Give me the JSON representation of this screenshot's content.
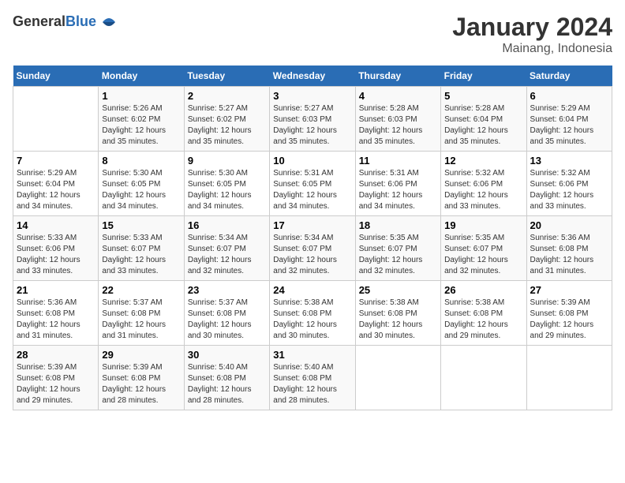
{
  "logo": {
    "general": "General",
    "blue": "Blue"
  },
  "title": "January 2024",
  "subtitle": "Mainang, Indonesia",
  "days_header": [
    "Sunday",
    "Monday",
    "Tuesday",
    "Wednesday",
    "Thursday",
    "Friday",
    "Saturday"
  ],
  "weeks": [
    [
      {
        "day": "",
        "sunrise": "",
        "sunset": "",
        "daylight": ""
      },
      {
        "day": "1",
        "sunrise": "Sunrise: 5:26 AM",
        "sunset": "Sunset: 6:02 PM",
        "daylight": "Daylight: 12 hours and 35 minutes."
      },
      {
        "day": "2",
        "sunrise": "Sunrise: 5:27 AM",
        "sunset": "Sunset: 6:02 PM",
        "daylight": "Daylight: 12 hours and 35 minutes."
      },
      {
        "day": "3",
        "sunrise": "Sunrise: 5:27 AM",
        "sunset": "Sunset: 6:03 PM",
        "daylight": "Daylight: 12 hours and 35 minutes."
      },
      {
        "day": "4",
        "sunrise": "Sunrise: 5:28 AM",
        "sunset": "Sunset: 6:03 PM",
        "daylight": "Daylight: 12 hours and 35 minutes."
      },
      {
        "day": "5",
        "sunrise": "Sunrise: 5:28 AM",
        "sunset": "Sunset: 6:04 PM",
        "daylight": "Daylight: 12 hours and 35 minutes."
      },
      {
        "day": "6",
        "sunrise": "Sunrise: 5:29 AM",
        "sunset": "Sunset: 6:04 PM",
        "daylight": "Daylight: 12 hours and 35 minutes."
      }
    ],
    [
      {
        "day": "7",
        "sunrise": "Sunrise: 5:29 AM",
        "sunset": "Sunset: 6:04 PM",
        "daylight": "Daylight: 12 hours and 34 minutes."
      },
      {
        "day": "8",
        "sunrise": "Sunrise: 5:30 AM",
        "sunset": "Sunset: 6:05 PM",
        "daylight": "Daylight: 12 hours and 34 minutes."
      },
      {
        "day": "9",
        "sunrise": "Sunrise: 5:30 AM",
        "sunset": "Sunset: 6:05 PM",
        "daylight": "Daylight: 12 hours and 34 minutes."
      },
      {
        "day": "10",
        "sunrise": "Sunrise: 5:31 AM",
        "sunset": "Sunset: 6:05 PM",
        "daylight": "Daylight: 12 hours and 34 minutes."
      },
      {
        "day": "11",
        "sunrise": "Sunrise: 5:31 AM",
        "sunset": "Sunset: 6:06 PM",
        "daylight": "Daylight: 12 hours and 34 minutes."
      },
      {
        "day": "12",
        "sunrise": "Sunrise: 5:32 AM",
        "sunset": "Sunset: 6:06 PM",
        "daylight": "Daylight: 12 hours and 33 minutes."
      },
      {
        "day": "13",
        "sunrise": "Sunrise: 5:32 AM",
        "sunset": "Sunset: 6:06 PM",
        "daylight": "Daylight: 12 hours and 33 minutes."
      }
    ],
    [
      {
        "day": "14",
        "sunrise": "Sunrise: 5:33 AM",
        "sunset": "Sunset: 6:06 PM",
        "daylight": "Daylight: 12 hours and 33 minutes."
      },
      {
        "day": "15",
        "sunrise": "Sunrise: 5:33 AM",
        "sunset": "Sunset: 6:07 PM",
        "daylight": "Daylight: 12 hours and 33 minutes."
      },
      {
        "day": "16",
        "sunrise": "Sunrise: 5:34 AM",
        "sunset": "Sunset: 6:07 PM",
        "daylight": "Daylight: 12 hours and 32 minutes."
      },
      {
        "day": "17",
        "sunrise": "Sunrise: 5:34 AM",
        "sunset": "Sunset: 6:07 PM",
        "daylight": "Daylight: 12 hours and 32 minutes."
      },
      {
        "day": "18",
        "sunrise": "Sunrise: 5:35 AM",
        "sunset": "Sunset: 6:07 PM",
        "daylight": "Daylight: 12 hours and 32 minutes."
      },
      {
        "day": "19",
        "sunrise": "Sunrise: 5:35 AM",
        "sunset": "Sunset: 6:07 PM",
        "daylight": "Daylight: 12 hours and 32 minutes."
      },
      {
        "day": "20",
        "sunrise": "Sunrise: 5:36 AM",
        "sunset": "Sunset: 6:08 PM",
        "daylight": "Daylight: 12 hours and 31 minutes."
      }
    ],
    [
      {
        "day": "21",
        "sunrise": "Sunrise: 5:36 AM",
        "sunset": "Sunset: 6:08 PM",
        "daylight": "Daylight: 12 hours and 31 minutes."
      },
      {
        "day": "22",
        "sunrise": "Sunrise: 5:37 AM",
        "sunset": "Sunset: 6:08 PM",
        "daylight": "Daylight: 12 hours and 31 minutes."
      },
      {
        "day": "23",
        "sunrise": "Sunrise: 5:37 AM",
        "sunset": "Sunset: 6:08 PM",
        "daylight": "Daylight: 12 hours and 30 minutes."
      },
      {
        "day": "24",
        "sunrise": "Sunrise: 5:38 AM",
        "sunset": "Sunset: 6:08 PM",
        "daylight": "Daylight: 12 hours and 30 minutes."
      },
      {
        "day": "25",
        "sunrise": "Sunrise: 5:38 AM",
        "sunset": "Sunset: 6:08 PM",
        "daylight": "Daylight: 12 hours and 30 minutes."
      },
      {
        "day": "26",
        "sunrise": "Sunrise: 5:38 AM",
        "sunset": "Sunset: 6:08 PM",
        "daylight": "Daylight: 12 hours and 29 minutes."
      },
      {
        "day": "27",
        "sunrise": "Sunrise: 5:39 AM",
        "sunset": "Sunset: 6:08 PM",
        "daylight": "Daylight: 12 hours and 29 minutes."
      }
    ],
    [
      {
        "day": "28",
        "sunrise": "Sunrise: 5:39 AM",
        "sunset": "Sunset: 6:08 PM",
        "daylight": "Daylight: 12 hours and 29 minutes."
      },
      {
        "day": "29",
        "sunrise": "Sunrise: 5:39 AM",
        "sunset": "Sunset: 6:08 PM",
        "daylight": "Daylight: 12 hours and 28 minutes."
      },
      {
        "day": "30",
        "sunrise": "Sunrise: 5:40 AM",
        "sunset": "Sunset: 6:08 PM",
        "daylight": "Daylight: 12 hours and 28 minutes."
      },
      {
        "day": "31",
        "sunrise": "Sunrise: 5:40 AM",
        "sunset": "Sunset: 6:08 PM",
        "daylight": "Daylight: 12 hours and 28 minutes."
      },
      {
        "day": "",
        "sunrise": "",
        "sunset": "",
        "daylight": ""
      },
      {
        "day": "",
        "sunrise": "",
        "sunset": "",
        "daylight": ""
      },
      {
        "day": "",
        "sunrise": "",
        "sunset": "",
        "daylight": ""
      }
    ]
  ]
}
